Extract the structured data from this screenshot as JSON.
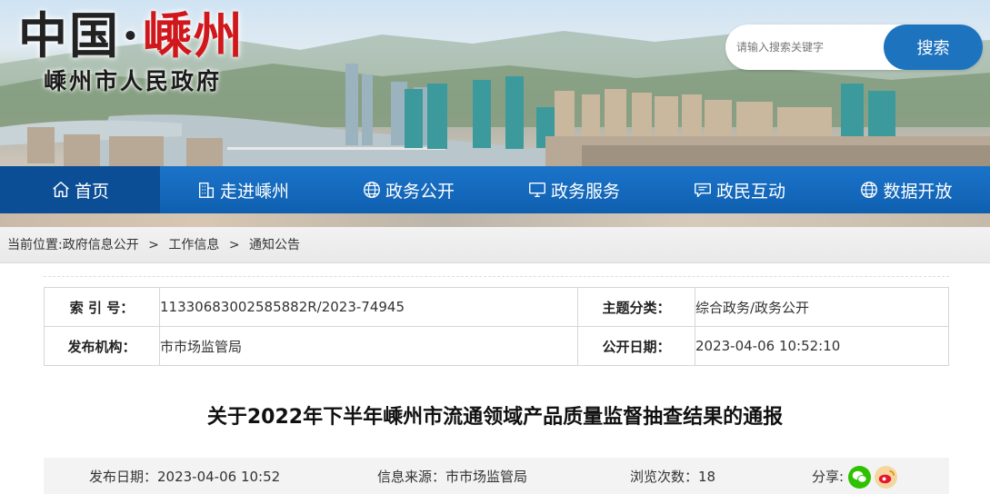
{
  "header": {
    "logo_main": {
      "part1": "中国",
      "dot": "·",
      "part2": "嵊州"
    },
    "logo_sub": "嵊州市人民政府",
    "search": {
      "placeholder": "请输入搜索关键字",
      "button_label": "搜索"
    }
  },
  "nav": {
    "items": [
      {
        "label": "首页",
        "icon": "home-icon",
        "active": true
      },
      {
        "label": "走进嵊州",
        "icon": "building-icon",
        "active": false
      },
      {
        "label": "政务公开",
        "icon": "globe-icon",
        "active": false
      },
      {
        "label": "政务服务",
        "icon": "monitor-icon",
        "active": false
      },
      {
        "label": "政民互动",
        "icon": "chat-icon",
        "active": false
      },
      {
        "label": "数据开放",
        "icon": "globe-icon",
        "active": false
      }
    ]
  },
  "breadcrumb": {
    "prefix": "当前位置:",
    "items": [
      "政府信息公开",
      "工作信息",
      "通知公告"
    ],
    "separator": ">"
  },
  "info": {
    "index_label": "索 引 号：",
    "index_value": "11330683002585882R/2023-74945",
    "topic_label": "主题分类：",
    "topic_value": "综合政务/政务公开",
    "issuer_label": "发布机构：",
    "issuer_value": "市市场监管局",
    "open_date_label": "公开日期：",
    "open_date_value": "2023-04-06 10:52:10"
  },
  "article": {
    "title": "关于2022年下半年嵊州市流通领域产品质量监督抽查结果的通报",
    "publish_date": "发布日期：2023-04-06 10:52",
    "source": "信息来源：市市场监管局",
    "views": "浏览次数：18",
    "share_label": "分享:"
  },
  "colors": {
    "nav_bg": "#1666bb",
    "nav_active": "#0c4e96",
    "search_button": "#1e73be",
    "logo_red": "#d0171b",
    "wechat_green": "#2dc100",
    "weibo_red": "#e6162d"
  }
}
